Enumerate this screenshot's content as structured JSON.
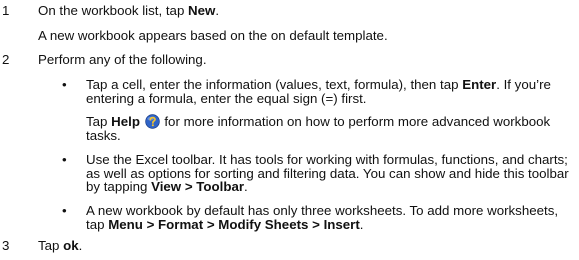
{
  "steps": [
    {
      "number": "1",
      "pre": "On the workbook list, tap ",
      "bold": "New",
      "post": "."
    },
    {
      "number": "2",
      "text": "Perform any of the following."
    },
    {
      "number": "3",
      "pre": "Tap ",
      "bold": "ok",
      "post": "."
    }
  ],
  "step1_note": "A new workbook appears based on the on default template.",
  "bullet_symbol": "•",
  "bullet1": {
    "pre": "Tap a cell, enter the information (values, text, formula), then tap ",
    "bold": "Enter",
    "post": ". If you’re entering a formula, enter the equal sign (=) first."
  },
  "help_note": {
    "pre": "Tap ",
    "bold": "Help",
    "icon": "help-question-icon",
    "post": " for more information on how to perform more advanced workbook tasks."
  },
  "bullet2": {
    "pre": "Use the Excel toolbar. It has tools for working with formulas, functions, and charts; as well as options for sorting and filtering data. You can show and hide this toolbar by tapping ",
    "bold": "View > Toolbar",
    "post": "."
  },
  "bullet3": {
    "pre": "A new workbook by default has only three worksheets. To add more worksheets, tap ",
    "bold": "Menu > Format > Modify Sheets > Insert",
    "post": "."
  },
  "colors": {
    "help_icon_blue": "#2f64c8",
    "help_icon_yellow": "#f2c230",
    "text": "#111111"
  }
}
